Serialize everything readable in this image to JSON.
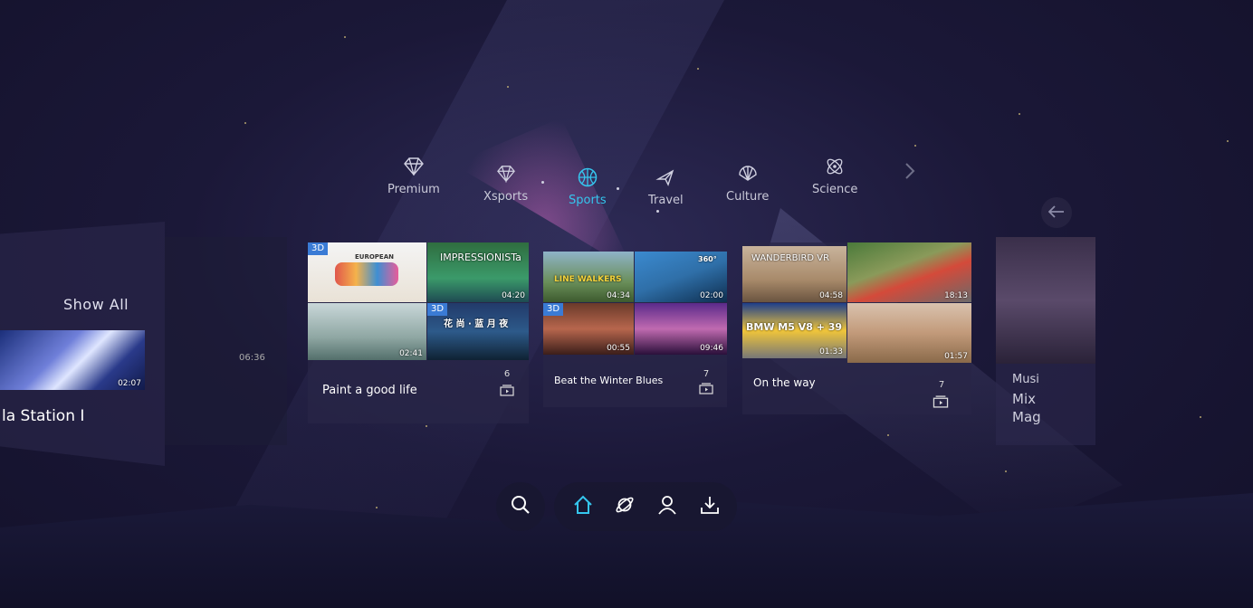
{
  "categories": [
    {
      "label": "Premium",
      "icon": "diamond-icon",
      "active": false
    },
    {
      "label": "Xsports",
      "icon": "diamond-icon",
      "active": false
    },
    {
      "label": "Sports",
      "icon": "basketball-icon",
      "active": true
    },
    {
      "label": "Travel",
      "icon": "airplane-icon",
      "active": false
    },
    {
      "label": "Culture",
      "icon": "fan-icon",
      "active": false
    },
    {
      "label": "Science",
      "icon": "atom-icon",
      "active": false
    }
  ],
  "left_panel": {
    "show_all": "Show All",
    "title": "la Station I",
    "duration": "02:07",
    "duration2": "06:36"
  },
  "playlists": [
    {
      "title": "Paint a good life",
      "count": "6",
      "thumbs": [
        {
          "duration": "",
          "badge": "3D",
          "text": "EUROPEAN"
        },
        {
          "duration": "04:20",
          "badge": "",
          "text": "IMPRESSIONISTa"
        },
        {
          "duration": "02:41",
          "badge": "",
          "text": ""
        },
        {
          "duration": "",
          "badge": "3D",
          "text": "花 尚 · 蓝 月 夜"
        }
      ]
    },
    {
      "title": "Beat the Winter Blues",
      "count": "7",
      "thumbs": [
        {
          "duration": "04:34",
          "badge": "",
          "text": "LINE WALKERS"
        },
        {
          "duration": "02:00",
          "badge": "",
          "text": "360°"
        },
        {
          "duration": "00:55",
          "badge": "3D",
          "text": ""
        },
        {
          "duration": "09:46",
          "badge": "",
          "text": ""
        }
      ]
    },
    {
      "title": "On the way",
      "count": "7",
      "thumbs": [
        {
          "duration": "04:58",
          "badge": "",
          "text": "WANDERBIRD VR"
        },
        {
          "duration": "18:13",
          "badge": "",
          "text": ""
        },
        {
          "duration": "01:33",
          "badge": "",
          "text": "BMW M5 V8 + 39"
        },
        {
          "duration": "01:57",
          "badge": "",
          "text": ""
        }
      ]
    }
  ],
  "right_panel": {
    "lines": [
      "Musi",
      "Mix",
      "Mag"
    ]
  },
  "toolbar": {
    "search_icon": "search-icon",
    "home_icon": "home-icon",
    "explore_icon": "planet-icon",
    "profile_icon": "user-icon",
    "download_icon": "download-icon"
  },
  "colors": {
    "accent": "#35c6ee",
    "badge3d": "#3a7bd5"
  }
}
